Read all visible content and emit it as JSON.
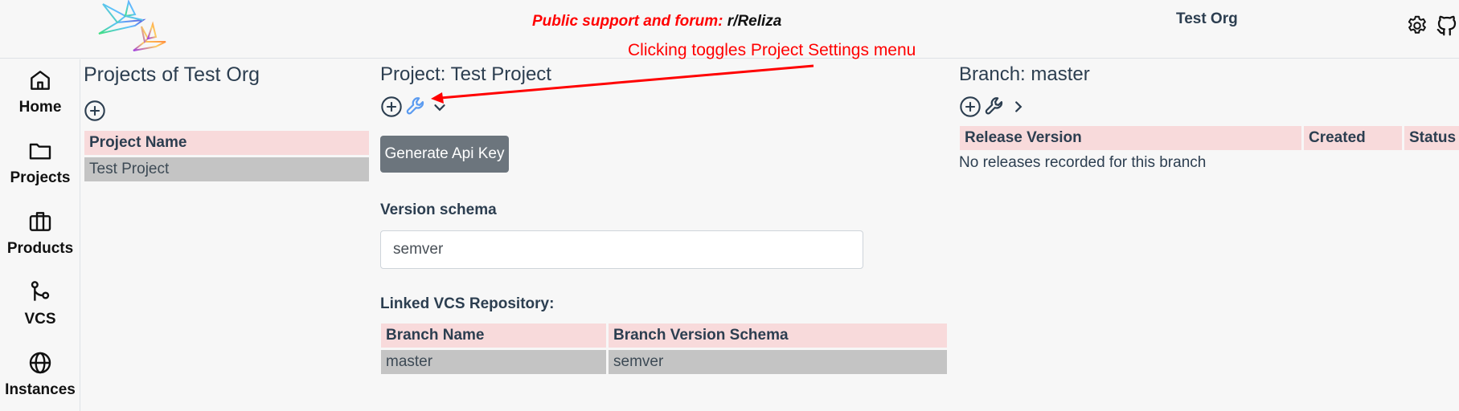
{
  "header": {
    "support_prefix": "Public support and forum: ",
    "support_link": "r/Reliza",
    "org_name": "Test Org",
    "icons": [
      "logo-birds",
      "gear-icon",
      "github-icon"
    ]
  },
  "sidebar": {
    "items": [
      {
        "label": "Home",
        "icon": "home-icon"
      },
      {
        "label": "Projects",
        "icon": "folder-icon"
      },
      {
        "label": "Products",
        "icon": "briefcase-icon"
      },
      {
        "label": "VCS",
        "icon": "git-branch-icon"
      },
      {
        "label": "Instances",
        "icon": "globe-icon"
      }
    ]
  },
  "annotation": {
    "text": "Clicking toggles Project Settings menu",
    "color": "#ff0000"
  },
  "projects": {
    "title": "Projects of Test Org",
    "table": {
      "headers": [
        "Project Name"
      ],
      "rows": [
        [
          "Test Project"
        ]
      ]
    }
  },
  "project": {
    "title": "Project: Test Project",
    "generate_api_key_label": "Generate Api Key",
    "version_schema_label": "Version schema",
    "version_schema_value": "semver",
    "linked_vcs_label": "Linked VCS Repository:",
    "vcs_table": {
      "headers": [
        "Branch Name",
        "Branch Version Schema"
      ],
      "rows": [
        [
          "master",
          "semver"
        ]
      ]
    },
    "settings_icon_color": "#5b9bf0"
  },
  "branch": {
    "title": "Branch: master",
    "table": {
      "headers": [
        "Release Version",
        "Created",
        "Status"
      ],
      "rows": []
    },
    "empty_message": "No releases recorded for this branch"
  },
  "colors": {
    "header_row_bg": "#f8dadb",
    "body_row_bg": "#c4c4c4",
    "button_bg": "#6c757d",
    "text": "#2c3e50",
    "support_red": "#ff0000"
  }
}
